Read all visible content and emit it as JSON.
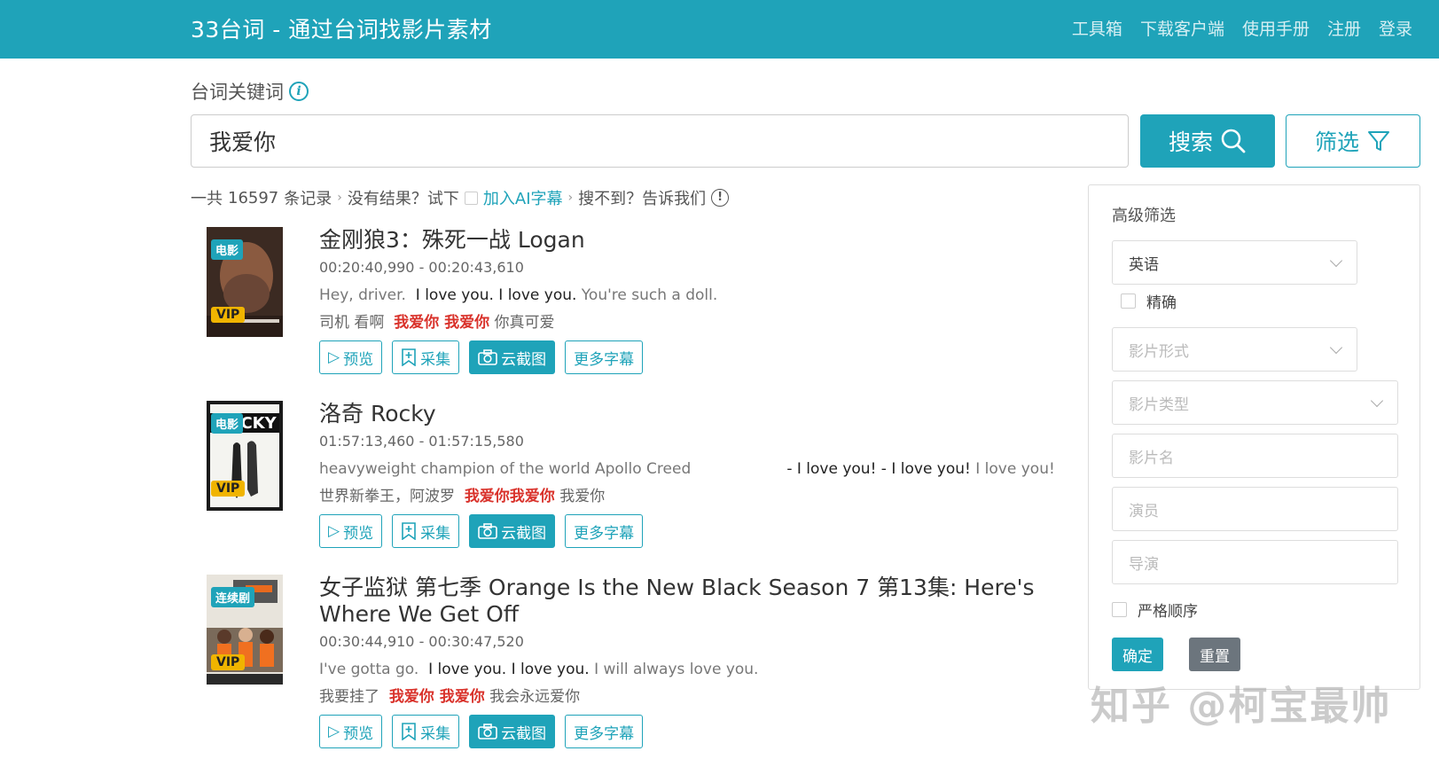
{
  "header": {
    "brand": "33台词 - 通过台词找影片素材",
    "nav": [
      "工具箱",
      "下载客户端",
      "使用手册",
      "注册",
      "登录"
    ]
  },
  "search": {
    "label": "台词关键词",
    "value": "我爱你",
    "search_label": "搜索",
    "filter_label": "筛选"
  },
  "stats": {
    "total_prefix": "一共",
    "count": "16597",
    "total_suffix": "条记录",
    "no_result": "没有结果？试下",
    "ai_link": "加入AI字幕",
    "not_found": "搜不到？告诉我们"
  },
  "actions": {
    "preview": "预览",
    "collect": "采集",
    "screenshot": "云截图",
    "more_subs": "更多字幕"
  },
  "results": [
    {
      "type_badge": "电影",
      "vip": "VIP",
      "title": "金刚狼3：殊死一战 Logan",
      "time": "00:20:40,990 - 00:20:43,610",
      "en_pre": "Hey, driver.  ",
      "en_hl": "I love you. I love you.",
      "en_post": " You're such a doll.",
      "cn_pre": "司机 看啊  ",
      "cn_hl": "我爱你 我爱你",
      "cn_post": " 你真可爱"
    },
    {
      "type_badge": "电影",
      "vip": "VIP",
      "title": "洛奇 Rocky",
      "time": "01:57:13,460 - 01:57:15,580",
      "en_pre": "heavyweight champion of the world Apollo Creed                    ",
      "en_hl": "- I love you! - I love you!",
      "en_post": " I love you!",
      "cn_pre": "世界新拳王，阿波罗  ",
      "cn_hl": "我爱你我爱你",
      "cn_post": " 我爱你"
    },
    {
      "type_badge": "连续剧",
      "vip": "VIP",
      "title": "女子监狱 第七季 Orange Is the New Black Season 7 第13集: Here's Where We Get Off",
      "time": "00:30:44,910 - 00:30:47,520",
      "en_pre": "I've gotta go.  ",
      "en_hl": "I love you. I love you.",
      "en_post": " I will always love you.",
      "cn_pre": "我要挂了  ",
      "cn_hl": "我爱你 我爱你",
      "cn_post": " 我会永远爱你"
    }
  ],
  "advanced": {
    "title": "高级筛选",
    "language": "英语",
    "exact": "精确",
    "format_placeholder": "影片形式",
    "genre_placeholder": "影片类型",
    "name_placeholder": "影片名",
    "actor_placeholder": "演员",
    "director_placeholder": "导演",
    "strict_order": "严格顺序",
    "ok": "确定",
    "reset": "重置"
  },
  "watermark": "知乎 @柯宝最帅"
}
